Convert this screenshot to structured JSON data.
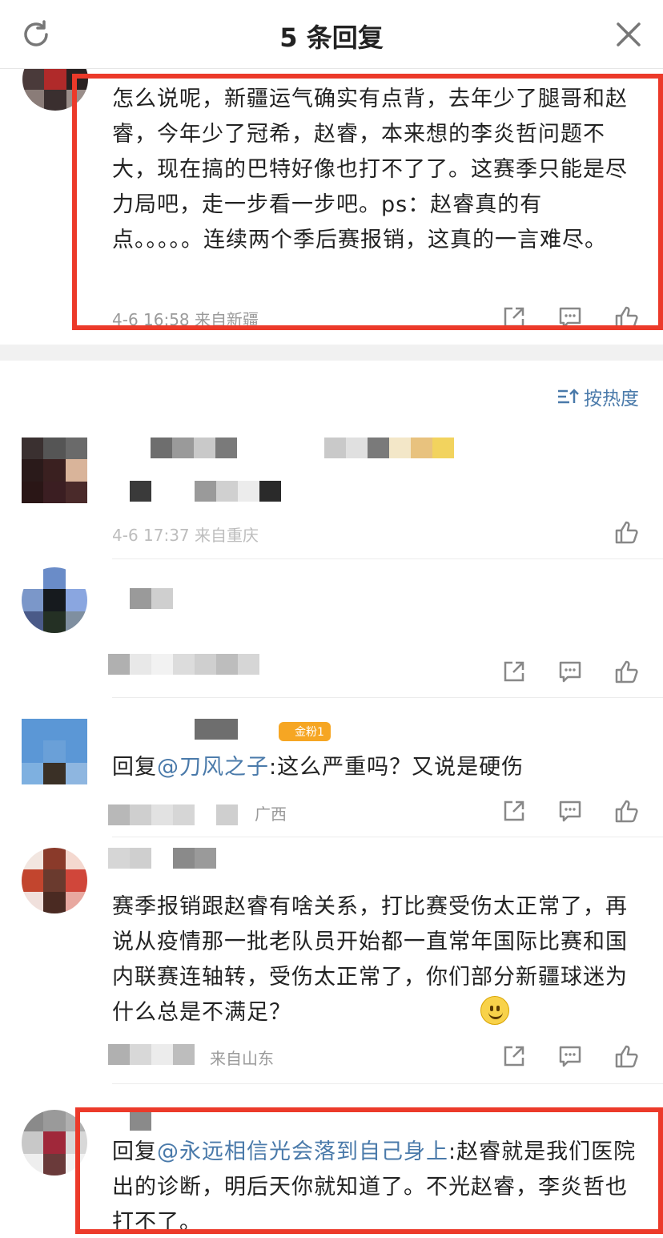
{
  "header": {
    "title": "5 条回复"
  },
  "main_comment": {
    "text": "怎么说呢，新疆运气确实有点背，去年少了腿哥和赵睿，今年少了冠希，赵睿，本来想的李炎哲问题不大，现在搞的巴特好像也打不了了。这赛季只能是尽力局吧，走一步看一步吧。ps：赵睿真的有点。。。。。连续两个季后赛报销，这真的一言难尽。",
    "meta": "4-6 16:58 来自新疆"
  },
  "sort": {
    "label": "按热度"
  },
  "replies": [
    {
      "text": "",
      "meta": "4-6 17:37 来自重庆"
    },
    {
      "text": "",
      "meta": ""
    },
    {
      "reply_prefix": "回复",
      "mention": "@刀风之子",
      "text": ":这么严重吗？又说是硬伤",
      "meta": "广西",
      "badge": "金粉1"
    },
    {
      "text": "赛季报销跟赵睿有啥关系，打比赛受伤太正常了，再说从疫情那一批老队员开始都一直常年国际比赛和国内联赛连轴转，受伤太正常了，你们部分新疆球迷为什么总是不满足？",
      "meta": "来自山东"
    },
    {
      "reply_prefix": "回复",
      "mention": "@永远相信光会落到自己身上",
      "text": ":赵睿就是我们医院出的诊断，明后天你就知道了。不光赵睿，李炎哲也打不了。"
    }
  ],
  "icons": [
    "refresh-icon",
    "close-icon",
    "share-icon",
    "comment-icon",
    "like-icon",
    "sort-icon",
    "smile-emoji-icon"
  ],
  "colors": {
    "highlight": "#ec3a2a",
    "link": "#4a7aaa",
    "badge": "#f6a623"
  }
}
